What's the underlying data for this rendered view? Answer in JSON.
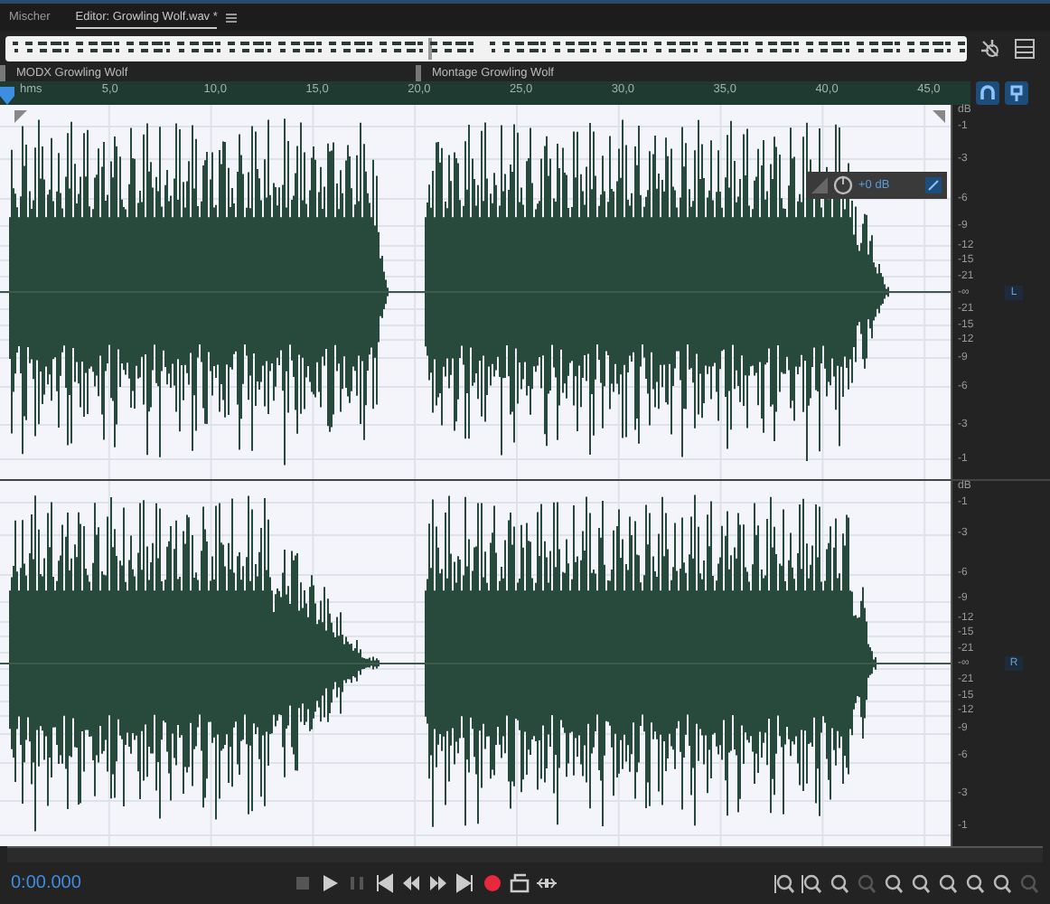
{
  "tabs": [
    {
      "label": "Mischer",
      "selected": false
    },
    {
      "label": "Editor: Growling Wolf.wav *",
      "selected": true
    }
  ],
  "markers": [
    "MODX Growling Wolf",
    "Montage Growling Wolf"
  ],
  "ruler": [
    "hms",
    "5,0",
    "10,0",
    "15,0",
    "20,0",
    "25,0",
    "30,0",
    "35,0",
    "40,0",
    "45,0"
  ],
  "volume": "+0 dB",
  "channels": [
    {
      "label": "L",
      "scale": [
        "dB",
        "-1",
        "-3",
        "-6",
        "-9",
        "-12",
        "-15",
        "-21",
        "-∞",
        "-21",
        "-15",
        "-12",
        "-9",
        "-6",
        "-3",
        "-1"
      ]
    },
    {
      "label": "R",
      "scale": [
        "dB",
        "-1",
        "-3",
        "-6",
        "-9",
        "-12",
        "-15",
        "-21",
        "-∞",
        "-21",
        "-15",
        "-12",
        "-9",
        "-6",
        "-3",
        "-1"
      ]
    }
  ],
  "time": "0:00.000"
}
